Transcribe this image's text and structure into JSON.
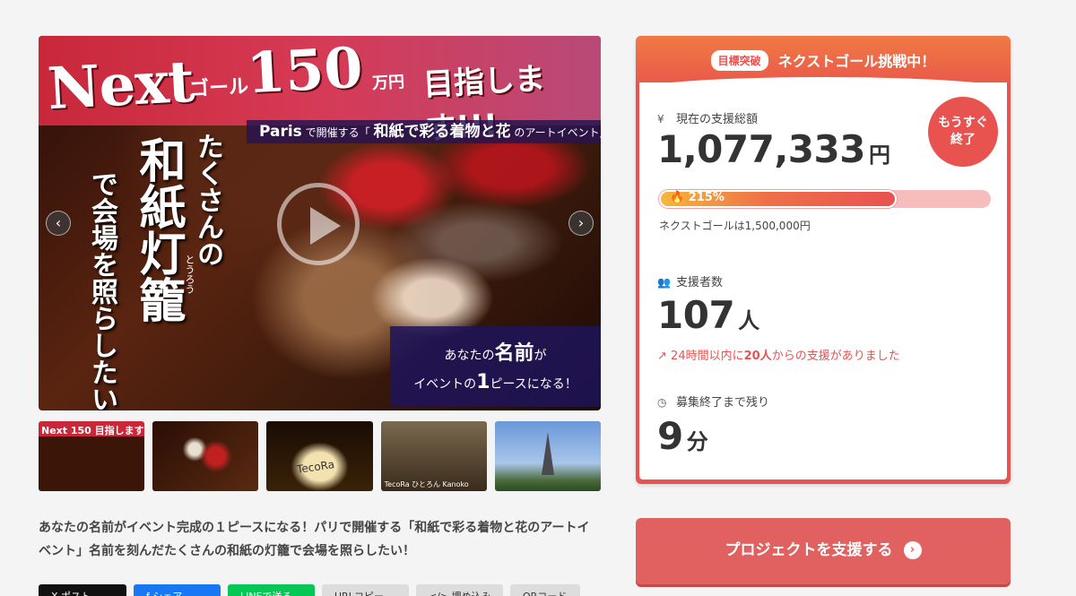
{
  "hero": {
    "next": "Next",
    "goal": "ゴール",
    "amount": "150",
    "man_yen": "万円",
    "aim": "目指します!!!",
    "paris_prefix": "Paris",
    "paris_mid": "で開催する「",
    "paris_bold": "和紙で彩る着物と花",
    "paris_suffix": "のアートイベント」",
    "vertical_1": "たくさんの",
    "vertical_2": "和紙灯籠",
    "vertical_3": "で会場を照らしたい",
    "ruby": "とうろう",
    "name_pre": "あなたの",
    "name_bold": "名前",
    "name_post": "が",
    "piece_pre": "イベントの",
    "piece_bold": "1",
    "piece_post": "ピースになる！"
  },
  "thumbs": [
    {
      "label": "Next 150 目指します"
    },
    {
      "label": ""
    },
    {
      "label": "TecoRa"
    },
    {
      "label": "TecoRa  ひとろん  Kanoko"
    },
    {
      "label": ""
    }
  ],
  "description": "あなたの名前がイベント完成の１ピースになる！パリで開催する「和紙で彩る着物と花のアートイベント」名前を刻んだたくさんの和紙の灯籠で会場を照らしたい！",
  "share": {
    "x": "X ポスト",
    "facebook": "f シェア",
    "line": "LINEで送る",
    "url": "URLコピー",
    "embed": "</> 埋め込み",
    "qr": "QRコード"
  },
  "card": {
    "badge": "目標突破",
    "head_title": "ネクストゴール挑戦中！",
    "total_label": "現在の支援総額",
    "total_icon": "¥",
    "total_value": "1,077,333",
    "total_unit": "円",
    "soon_line1": "もうすぐ",
    "soon_line2": "終了",
    "progress_percent": 215,
    "progress_label": "215%",
    "next_goal_text": "ネクストゴールは1,500,000円",
    "supporters_label": "支援者数",
    "supporters_value": "107",
    "supporters_unit": "人",
    "trend_pre": "24時間以内に",
    "trend_bold": "20人",
    "trend_post": "からの支援がありました",
    "remaining_label": "募集終了まで残り",
    "remaining_value": "9",
    "remaining_unit": "分"
  },
  "cta": {
    "label": "プロジェクトを支援する"
  },
  "colors": {
    "accent": "#e8524f",
    "cta": "#e0615f"
  }
}
